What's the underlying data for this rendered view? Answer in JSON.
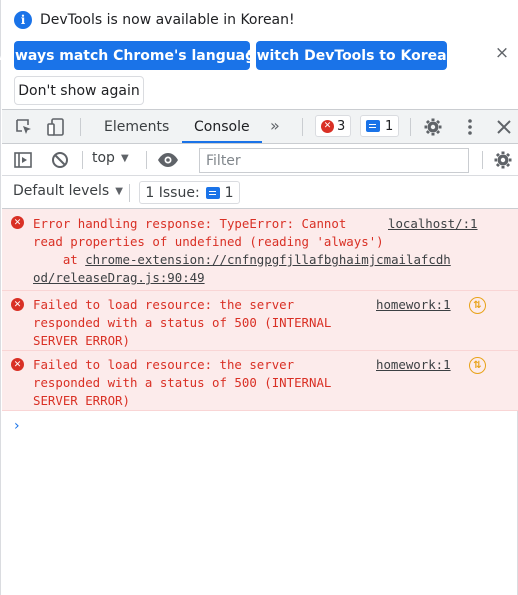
{
  "infobar": {
    "message": "DevTools is now available in Korean!",
    "match_button": "Always match Chrome's language",
    "switch_button": "Switch DevTools to Korean",
    "dismiss_button": "Don't show again",
    "close": "×"
  },
  "tabbar": {
    "tabs": [
      {
        "label": "Elements"
      },
      {
        "label": "Console"
      }
    ],
    "more": "»",
    "error_count": "3",
    "message_count": "1"
  },
  "toolbar": {
    "context": "top",
    "filter_placeholder": "Filter",
    "levels": "Default levels",
    "issues_label": "1 Issue:",
    "issues_count": "1"
  },
  "messages": [
    {
      "lines": [
        "Error handling response: TypeError: Cannot",
        "read properties of undefined (reading 'always')",
        "    at "
      ],
      "source": "localhost/:1",
      "trace_link": "chrome-extension://cnfngpgfjllafbghaimjcmailafcdh",
      "trace_link2": "od/releaseDrag.js:90:49"
    },
    {
      "lines": [
        "Failed to load resource: the server",
        "responded with a status of 500 (INTERNAL",
        "SERVER ERROR)"
      ],
      "source": "homework:1"
    },
    {
      "lines": [
        "Failed to load resource: the server",
        "responded with a status of 500 (INTERNAL",
        "SERVER ERROR)"
      ],
      "source": "homework:1"
    }
  ],
  "prompt": "›",
  "colors": {
    "accent": "#1a73e8",
    "error": "#d93025",
    "error_bg": "#fcebeb",
    "warning": "#e8a31a"
  }
}
